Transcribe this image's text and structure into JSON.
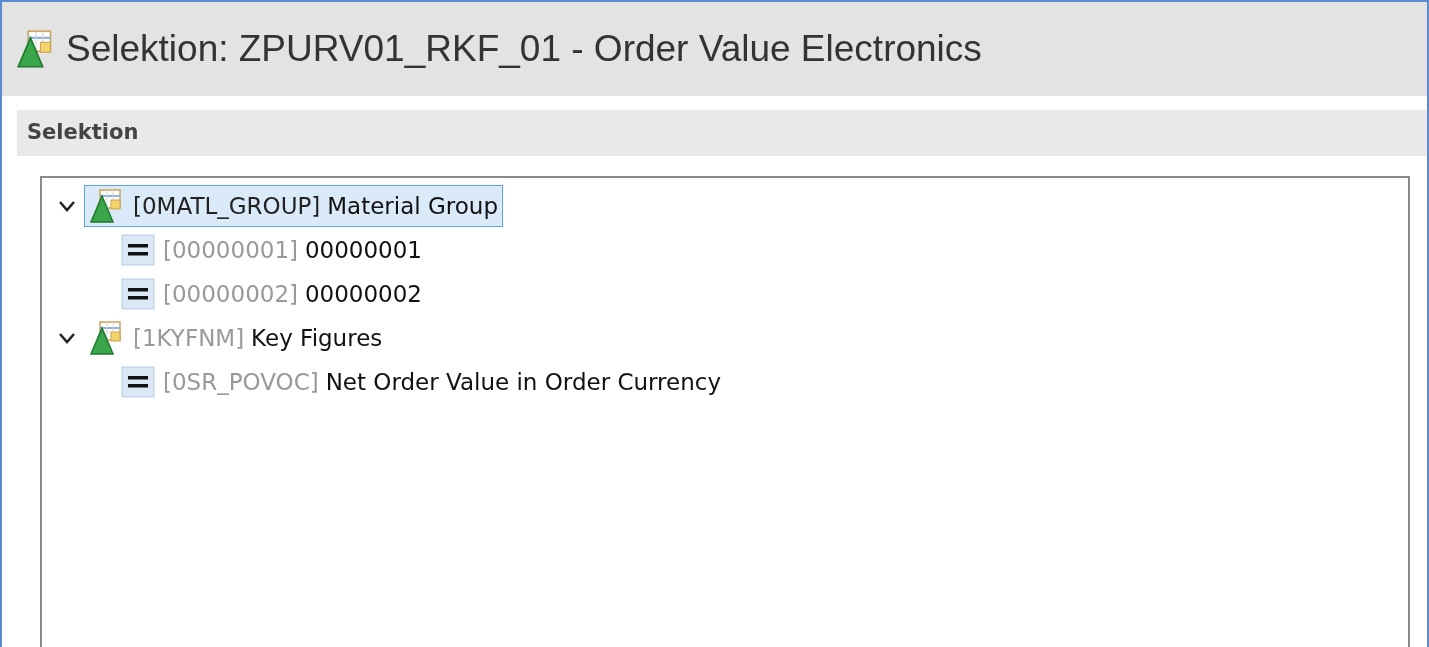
{
  "window": {
    "title": "Selektion: ZPURV01_RKF_01 - Order Value Electronics"
  },
  "section": {
    "title": "Selektion"
  },
  "tree": [
    {
      "kind": "characteristic",
      "key": "[0MATL_GROUP]",
      "text": "Material Group",
      "expanded": true,
      "selected": true,
      "children": [
        {
          "kind": "value",
          "key": "[00000001]",
          "text": "00000001",
          "selected": false
        },
        {
          "kind": "value",
          "key": "[00000002]",
          "text": "00000002",
          "selected": false
        }
      ]
    },
    {
      "kind": "characteristic",
      "key": "[1KYFNM]",
      "text": "Key Figures",
      "expanded": true,
      "selected": false,
      "children": [
        {
          "kind": "value",
          "key": "[0SR_POVOC]",
          "text": "Net Order Value in Order Currency",
          "selected": false
        }
      ]
    }
  ]
}
